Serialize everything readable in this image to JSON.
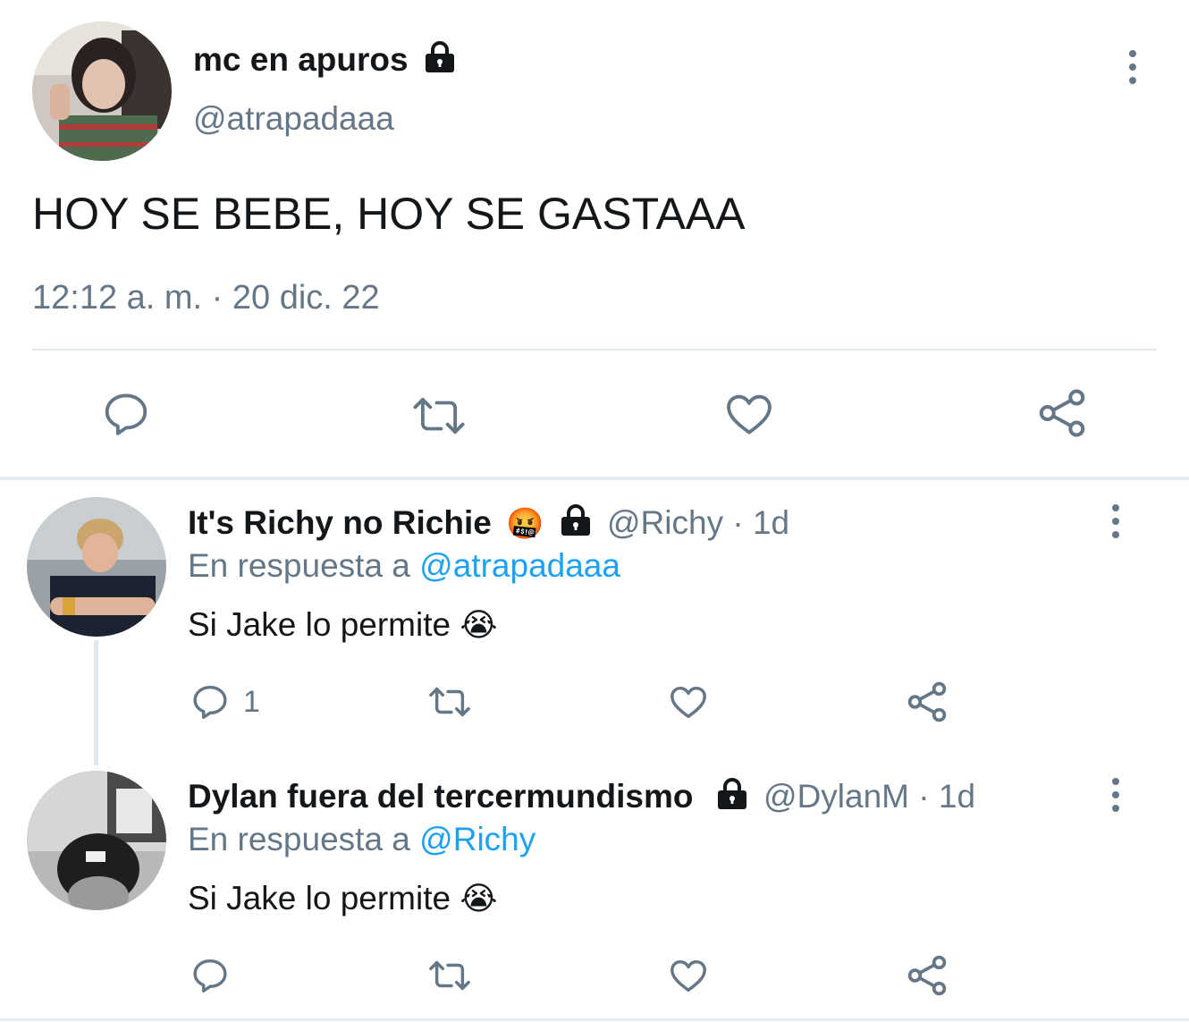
{
  "tweet": {
    "display_name": "mc en apuros",
    "handle": "@atrapadaaa",
    "text": "HOY SE BEBE, HOY SE GASTAAA",
    "timestamp": "12:12 a. m. · 20 dic. 22",
    "protected_icon": "lock-icon",
    "actions": [
      "reply-icon",
      "retweet-icon",
      "like-icon",
      "share-icon"
    ]
  },
  "replies": [
    {
      "display_name": "It's Richy no Richie",
      "emoji": "🤬",
      "handle": "@Richy",
      "age": "1d",
      "reply_prefix": "En respuesta a",
      "reply_to": "@atrapadaaa",
      "text": "Si Jake lo permite",
      "text_emoji": "😭",
      "reply_count": "1"
    },
    {
      "display_name": "Dylan fuera del tercermundismo",
      "handle": "@DylanM",
      "age": "1d",
      "reply_prefix": "En respuesta a",
      "reply_to": "@Richy",
      "text": "Si Jake lo permite",
      "text_emoji": "😭",
      "reply_count": ""
    }
  ],
  "colors": {
    "text": "#14171a",
    "secondary": "#657786",
    "link": "#1da1f2",
    "divider": "#e1e8ed"
  }
}
